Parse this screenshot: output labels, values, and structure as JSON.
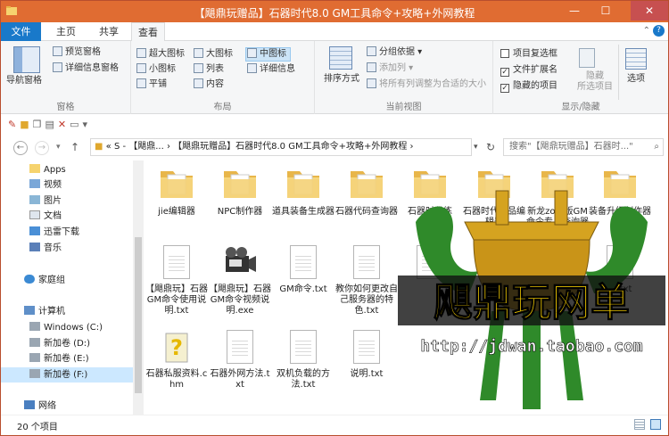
{
  "window": {
    "title": "【飓鼎玩赠品】石器时代8.0 GM工具命令+攻略+外网教程",
    "minimize": "—",
    "maximize": "☐",
    "close": "✕"
  },
  "tabs": [
    "文件",
    "主页",
    "共享",
    "查看"
  ],
  "ribbon": {
    "pane": {
      "nav_pane": "导航窗格",
      "preview": "预览窗格",
      "details": "详细信息窗格",
      "label": "窗格"
    },
    "layout": {
      "xl": "超大图标",
      "large": "大图标",
      "medium": "中图标",
      "small": "小图标",
      "list": "列表",
      "details": "详细信息",
      "tiles": "平铺",
      "content": "内容",
      "label": "布局"
    },
    "view": {
      "sort": "排序方式",
      "group": "分组依据",
      "add_col": "添加列",
      "fit_cols": "将所有列调整为合适的大小",
      "label": "当前视图"
    },
    "showhide": {
      "checkboxes": "项目复选框",
      "ext": "文件扩展名",
      "hidden": "隐藏的项目",
      "hide_sel": "隐藏",
      "hide_sel2": "所选项目",
      "options": "选项",
      "label": "显示/隐藏"
    }
  },
  "address": {
    "path": "«  S - 【飓鼎... › 【飓鼎玩赠品】石器时代8.0 GM工具命令+攻略+外网教程 ›",
    "search_placeholder": "搜索\"【飓鼎玩赠品】石器时...\""
  },
  "nav": [
    "Apps",
    "视频",
    "图片",
    "文档",
    "迅雷下载",
    "音乐",
    "家庭组",
    "计算机",
    "Windows (C:)",
    "新加卷 (D:)",
    "新加卷 (E:)",
    "新加卷 (F:)",
    "网络"
  ],
  "files": [
    {
      "name": "jie编辑器",
      "type": "folder"
    },
    {
      "name": "NPC制作器",
      "type": "folder"
    },
    {
      "name": "道具装备生成器",
      "type": "folder"
    },
    {
      "name": "石器代码查询器",
      "type": "folder"
    },
    {
      "name": "石器时代练",
      "type": "folder"
    },
    {
      "name": "石器时代物品编辑器",
      "type": "folder"
    },
    {
      "name": "新龙zoro版GM命令专用查询器",
      "type": "folder"
    },
    {
      "name": "装备升级制作器",
      "type": "folder"
    },
    {
      "name": "【飓鼎玩】石器GM命令使用说明.txt",
      "type": "doc"
    },
    {
      "name": "【飓鼎玩】石器GM命令视频说明.exe",
      "type": "exe"
    },
    {
      "name": "GM命令.txt",
      "type": "doc"
    },
    {
      "name": "教你如何更改自己服务器的特色.txt",
      "type": "doc"
    },
    {
      "name": "",
      "type": "doc"
    },
    {
      "name": "",
      "type": "doc"
    },
    {
      "name": "",
      "type": "doc"
    },
    {
      "name": "令.txt",
      "type": "doc"
    },
    {
      "name": "石器私服资料.chm",
      "type": "chm"
    },
    {
      "name": "石器外网方法.txt",
      "type": "doc"
    },
    {
      "name": "双机负载的方法.txt",
      "type": "doc"
    },
    {
      "name": "说明.txt",
      "type": "doc"
    }
  ],
  "status": {
    "count": "20 个项目"
  },
  "watermark": {
    "brand": "飓鼎玩网单",
    "url": "http://jdwan.taobao.com"
  },
  "colors": {
    "titlebar": "#e06c32",
    "file_tab": "#1979ca",
    "folder": "#f4d27a",
    "watermark_green": "#2f8a2a",
    "watermark_gold": "#d5a320",
    "watermark_text": "#e8c200"
  }
}
